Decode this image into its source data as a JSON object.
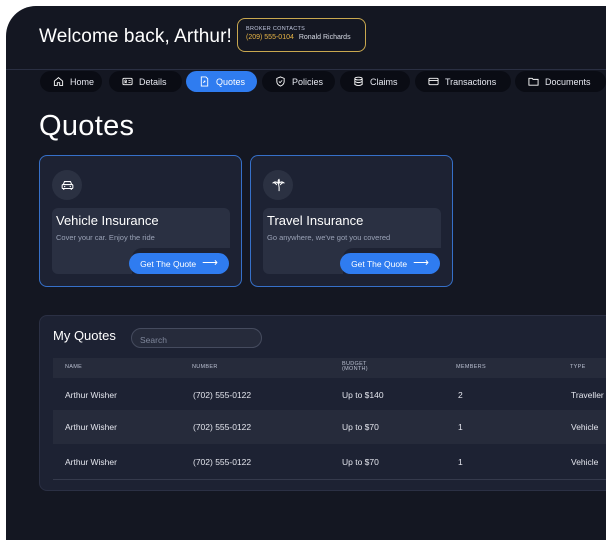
{
  "header": {
    "welcome": "Welcome back, Arthur!",
    "broker": {
      "title": "BROKER CONTACTS",
      "phone": "(209) 555-0104",
      "name": "Ronald Richards"
    }
  },
  "tabs": [
    {
      "label": "Home",
      "icon": "home-icon",
      "active": false
    },
    {
      "label": "Details",
      "icon": "id-card-icon",
      "active": false
    },
    {
      "label": "Quotes",
      "icon": "quote-document-icon",
      "active": true
    },
    {
      "label": "Policies",
      "icon": "shield-icon",
      "active": false
    },
    {
      "label": "Claims",
      "icon": "database-icon",
      "active": false
    },
    {
      "label": "Transactions",
      "icon": "credit-card-icon",
      "active": false
    },
    {
      "label": "Documents",
      "icon": "folder-icon",
      "active": false
    }
  ],
  "page_title": "Quotes",
  "cards": [
    {
      "icon": "car-icon",
      "title": "Vehicle Insurance",
      "subtitle": "Cover your car. Enjoy the ride",
      "cta": "Get The Quote"
    },
    {
      "icon": "palm-tree-icon",
      "title": "Travel Insurance",
      "subtitle": "Go anywhere, we've got you covered",
      "cta": "Get The Quote"
    }
  ],
  "my_quotes": {
    "title": "My Quotes",
    "search_placeholder": "Search",
    "columns": {
      "name": "NAME",
      "number": "NUMBER",
      "budget_line1": "BUDGET",
      "budget_line2": "(MONTH)",
      "members": "MEMBERS",
      "type": "TYPE"
    },
    "rows": [
      {
        "name": "Arthur Wisher",
        "number": "(702) 555-0122",
        "budget": "Up to $140",
        "members": "2",
        "type": "Traveller"
      },
      {
        "name": "Arthur Wisher",
        "number": "(702) 555-0122",
        "budget": "Up to $70",
        "members": "1",
        "type": "Vehicle"
      },
      {
        "name": "Arthur Wisher",
        "number": "(702) 555-0122",
        "budget": "Up to $70",
        "members": "1",
        "type": "Vehicle"
      }
    ]
  },
  "colors": {
    "background": "#141722",
    "accent": "#2f7cf0",
    "broker_border": "#c9a84f",
    "card_border": "#3670c9"
  }
}
